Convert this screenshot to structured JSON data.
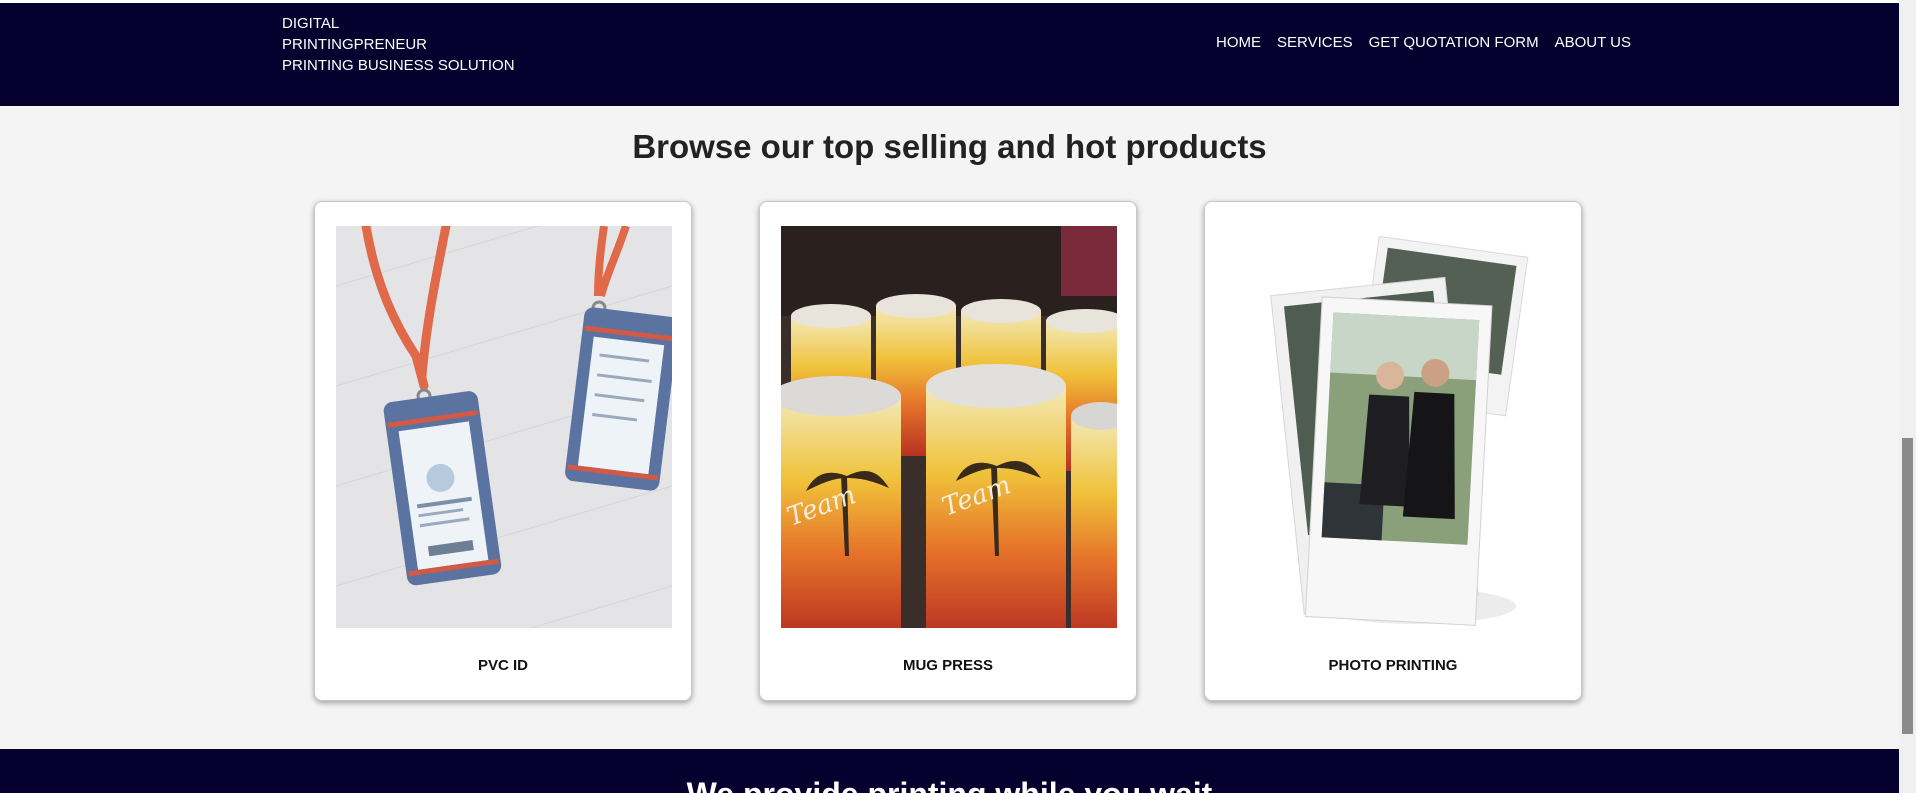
{
  "brand": {
    "line1": "DIGITAL",
    "line2": "PRINTINGPRENEUR",
    "line3": "PRINTING BUSINESS SOLUTION"
  },
  "nav": [
    {
      "label": "HOME"
    },
    {
      "label": "SERVICES"
    },
    {
      "label": "GET QUOTATION FORM"
    },
    {
      "label": "ABOUT US"
    }
  ],
  "products": {
    "heading": "Browse our top selling and hot products",
    "items": [
      {
        "label": "PVC ID",
        "image": "pvc-id-lanyard-photo"
      },
      {
        "label": "MUG PRESS",
        "image": "sublimation-mugs-photo"
      },
      {
        "label": "PHOTO PRINTING",
        "image": "polaroid-photo-prints"
      }
    ]
  },
  "footer_band": {
    "title": "We provide printing while you wait"
  },
  "colors": {
    "navy": "#05002d",
    "page_bg": "#f4f4f4",
    "card_bg": "#ffffff"
  }
}
